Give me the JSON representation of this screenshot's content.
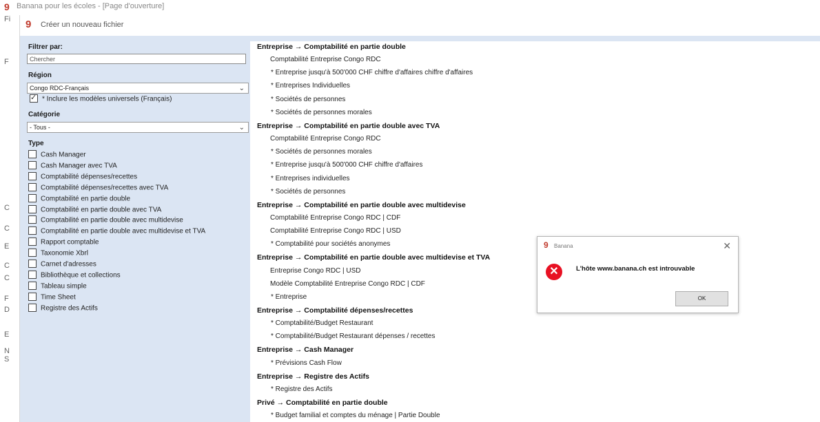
{
  "background_window": {
    "title": "Banana pour les écoles - [Page d'ouverture]",
    "left_letters": [
      "Fi",
      "F",
      "C",
      "C",
      "E",
      "C",
      "C",
      "F",
      "D",
      "E",
      "N",
      "S"
    ]
  },
  "dialog": {
    "title": "Créer un nouveau fichier",
    "filter": {
      "label": "Filtrer par:",
      "search_placeholder": "Chercher",
      "region_label": "Région",
      "region_value": "Congo RDC-Français",
      "universal_label": "* Inclure les modèles universels (Français)",
      "universal_checked": true,
      "category_label": "Catégorie",
      "category_value": "- Tous -",
      "type_label": "Type",
      "types": [
        "Cash Manager",
        "Cash Manager avec TVA",
        "Comptabilité dépenses/recettes",
        "Comptabilité dépenses/recettes avec TVA",
        "Comptabilité en partie double",
        "Comptabilité en partie double avec TVA",
        "Comptabilité en partie double avec multidevise",
        "Comptabilité en partie double avec multidevise et TVA",
        "Rapport comptable",
        "Taxonomie Xbrl",
        "Carnet d'adresses",
        "Bibliothèque et collections",
        "Tableau simple",
        "Time Sheet",
        "Registre des Actifs"
      ]
    },
    "templates": [
      {
        "text": "Entreprise → Comptabilité en partie double",
        "h": true
      },
      {
        "text": "Comptabilité Entreprise Congo RDC",
        "h": false
      },
      {
        "text": "* Entreprise jusqu'à 500'000 CHF chiffre d'affaires chiffre d'affaires",
        "h": false
      },
      {
        "text": "* Entreprises Individuelles",
        "h": false
      },
      {
        "text": "* Sociétés de personnes",
        "h": false
      },
      {
        "text": "* Sociétés de personnes morales",
        "h": false
      },
      {
        "text": "Entreprise → Comptabilité en partie double avec TVA",
        "h": true
      },
      {
        "text": "Comptabilité Entreprise Congo RDC",
        "h": false
      },
      {
        "text": "* Sociétés de personnes morales",
        "h": false
      },
      {
        "text": "* Entreprise jusqu'à 500'000 CHF chiffre d'affaires",
        "h": false
      },
      {
        "text": "* Entreprises individuelles",
        "h": false
      },
      {
        "text": "* Sociétés de personnes",
        "h": false
      },
      {
        "text": "Entreprise → Comptabilité en partie double avec multidevise",
        "h": true
      },
      {
        "text": "Comptabilité Entreprise Congo RDC | CDF",
        "h": false
      },
      {
        "text": "Comptabilité Entreprise Congo RDC | USD",
        "h": false
      },
      {
        "text": "* Comptabilité pour sociétés anonymes",
        "h": false
      },
      {
        "text": "Entreprise → Comptabilité en partie double avec multidevise et TVA",
        "h": true
      },
      {
        "text": "Entreprise Congo RDC | USD",
        "h": false
      },
      {
        "text": "Modèle Comptabilité Entreprise Congo RDC | CDF",
        "h": false
      },
      {
        "text": "* Entreprise",
        "h": false
      },
      {
        "text": "Entreprise → Comptabilité dépenses/recettes",
        "h": true
      },
      {
        "text": "* Comptabilité/Budget Restaurant",
        "h": false
      },
      {
        "text": "* Comptabilité/Budget Restaurant dépenses / recettes",
        "h": false
      },
      {
        "text": "Entreprise → Cash Manager",
        "h": true
      },
      {
        "text": "* Prévisions Cash Flow",
        "h": false
      },
      {
        "text": "Entreprise → Registre des Actifs",
        "h": true
      },
      {
        "text": "* Registre des Actifs",
        "h": false
      },
      {
        "text": "Privé → Comptabilité en partie double",
        "h": true
      },
      {
        "text": "* Budget familial et comptes du ménage | Partie Double",
        "h": false
      }
    ]
  },
  "alert": {
    "title": "Banana",
    "message": "L'hôte www.banana.ch est introuvable",
    "ok_label": "OK",
    "close_glyph": "✕",
    "error_glyph": "✕",
    "icon_color": "#e81123"
  },
  "logo_glyph": "9",
  "colors": {
    "panel_bg": "#dbe5f3",
    "brand": "#c0392b"
  }
}
